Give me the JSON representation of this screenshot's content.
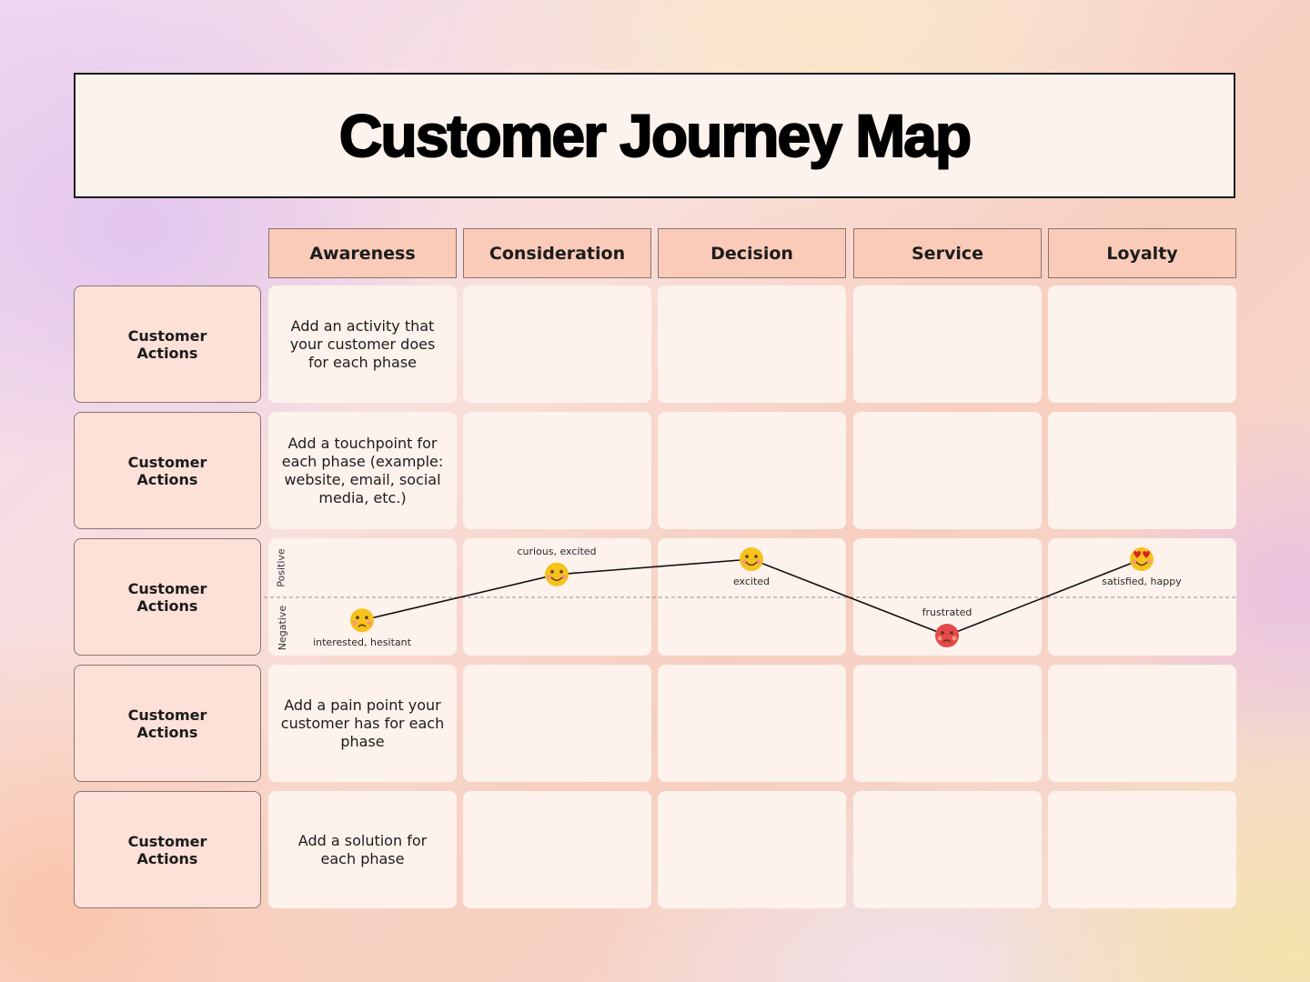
{
  "title": "Customer Journey Map",
  "phases": [
    "Awareness",
    "Consideration",
    "Decision",
    "Service",
    "Loyalty"
  ],
  "rows": [
    {
      "label": "Customer\nActions",
      "cells": [
        "Add an activity that your customer does for each phase",
        "",
        "",
        "",
        ""
      ]
    },
    {
      "label": "Customer\nActions",
      "cells": [
        "Add a touchpoint for each phase (example: website, email, social media, etc.)",
        "",
        "",
        "",
        ""
      ]
    },
    {
      "label": "Customer\nActions",
      "cells": [
        "",
        "",
        "",
        "",
        ""
      ]
    },
    {
      "label": "Customer\nActions",
      "cells": [
        "Add a pain point your customer has for each phase",
        "",
        "",
        "",
        ""
      ]
    },
    {
      "label": "Customer\nActions",
      "cells": [
        "Add a solution for each phase",
        "",
        "",
        "",
        ""
      ]
    }
  ],
  "emotion_axis": {
    "positive_label": "Positive",
    "negative_label": "Negative"
  },
  "emotions": [
    {
      "phase": "Awareness",
      "label": "interested, hesitant",
      "level": -0.6,
      "icon": "hesitant-face-icon",
      "color": "#f6c21b",
      "label_pos": "below"
    },
    {
      "phase": "Consideration",
      "label": "curious, excited",
      "level": 0.6,
      "icon": "smiling-face-icon",
      "color": "#f6c21b",
      "label_pos": "above"
    },
    {
      "phase": "Decision",
      "label": "excited",
      "level": 1.0,
      "icon": "happy-face-icon",
      "color": "#f6c21b",
      "label_pos": "below"
    },
    {
      "phase": "Service",
      "label": "frustrated",
      "level": -1.0,
      "icon": "angry-face-icon",
      "color": "#e54848",
      "label_pos": "above"
    },
    {
      "phase": "Loyalty",
      "label": "satisfied, happy",
      "level": 1.0,
      "icon": "heart-eyes-face-icon",
      "color": "#f6c21b",
      "label_pos": "below"
    }
  ]
}
